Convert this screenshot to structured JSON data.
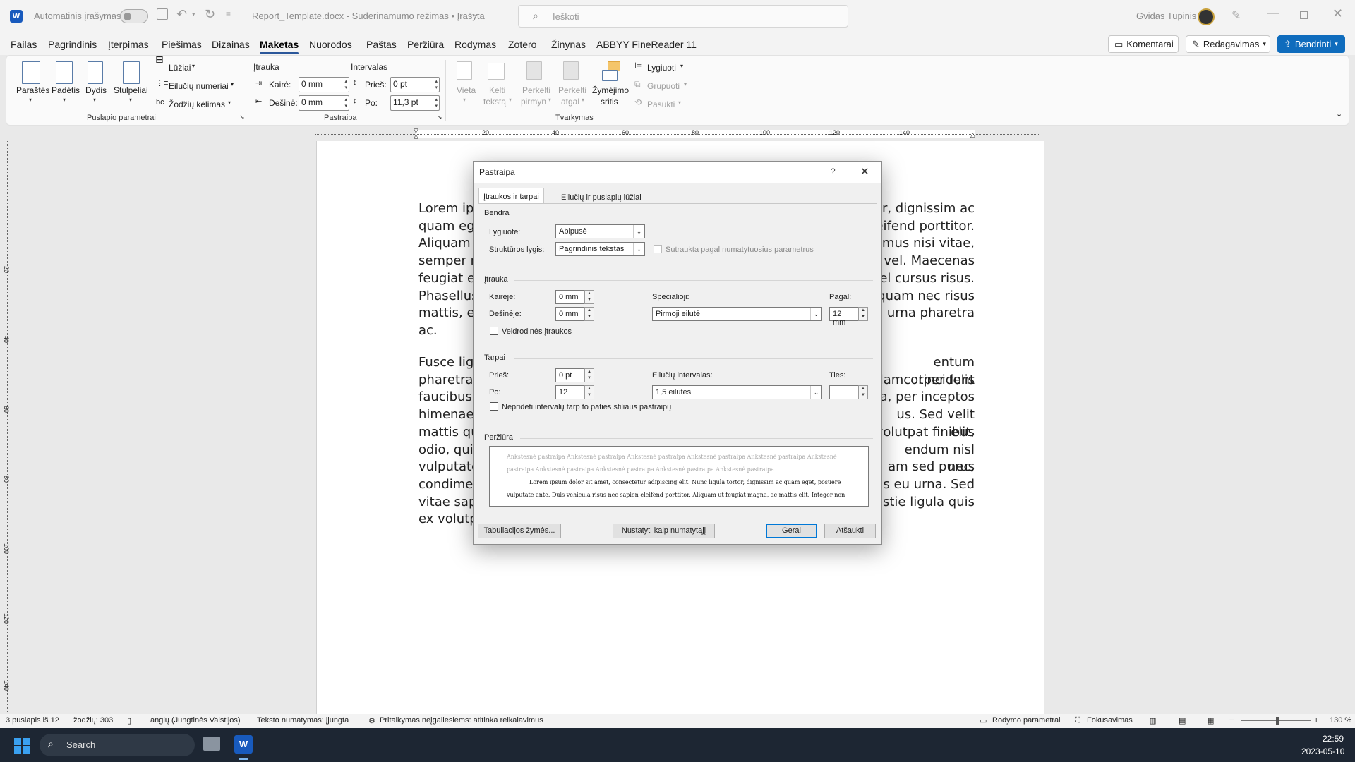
{
  "titlebar": {
    "autosave_label": "Automatinis įrašymas",
    "doc_title": "Report_Template.docx  -  Suderinamumo režimas  •  Įrašyta",
    "search_placeholder": "Ieškoti",
    "user_name": "Gvidas Tupinis"
  },
  "menu": {
    "items": [
      "Failas",
      "Pagrindinis",
      "Įterpimas",
      "Piešimas",
      "Dizainas",
      "Maketas",
      "Nuorodos",
      "Paštas",
      "Peržiūra",
      "Rodymas",
      "Zotero",
      "Žinynas",
      "ABBYY FineReader 11"
    ],
    "active": "Maketas",
    "comments_btn": "Komentarai",
    "editing_btn": "Redagavimas",
    "share_btn": "Bendrinti"
  },
  "ribbon": {
    "page_setup": {
      "margins": "Paraštės",
      "orientation": "Padėtis",
      "size": "Dydis",
      "columns": "Stulpeliai",
      "breaks": "Lūžiai",
      "line_numbers": "Eilučių numeriai",
      "hyphenation": "Žodžių kėlimas",
      "group_label": "Puslapio parametrai"
    },
    "paragraph": {
      "indent_title": "Įtrauka",
      "spacing_title": "Intervalas",
      "left_label": "Kairė:",
      "left_value": "0 mm",
      "right_label": "Dešinė:",
      "right_value": "0 mm",
      "before_label": "Prieš:",
      "before_value": "0 pt",
      "after_label": "Po:",
      "after_value": "11,3 pt",
      "group_label": "Pastraipa"
    },
    "arrange": {
      "position": "Vieta",
      "wrap_text_1": "Kelti",
      "wrap_text_2": "tekstą",
      "bring_forward_1": "Perkelti",
      "bring_forward_2": "pirmyn",
      "send_backward_1": "Perkelti",
      "send_backward_2": "atgal",
      "selection_pane_1": "Žymėjimo",
      "selection_pane_2": "sritis",
      "align": "Lygiuoti",
      "group": "Grupuoti",
      "rotate": "Pasukti",
      "group_label": "Tvarkymas"
    }
  },
  "ruler": {
    "top_ticks": [
      "20",
      "40",
      "60",
      "80",
      "100",
      "120",
      "140"
    ],
    "left_ticks": [
      "20",
      "40",
      "60",
      "80",
      "100",
      "120",
      "140"
    ]
  },
  "document": {
    "para1_lines": [
      "Lorem ip",
      "quam eg",
      "Aliquam",
      "semper n",
      "feugiat e",
      "Phasellus",
      "mattis, e",
      "ac."
    ],
    "para1_right": [
      "or, dignissim ac",
      "eifend porttitor.",
      "imus nisi vitae,",
      "vel. Maecenas",
      "el cursus risus.",
      "quam nec risus",
      "urna pharetra",
      ""
    ],
    "para2_lines": [
      "Fusce lig",
      "pharetra",
      "faucibus",
      "himenaeo",
      "mattis qu",
      "odio, qui",
      "vulputate",
      "condime",
      "vitae sap",
      "ex volutp"
    ],
    "para2_right": [
      "entum tincidunt",
      "llamcorper felis",
      "ra, per inceptos",
      "us. Sed velit elit,",
      "volutpat finibus",
      "endum nisl nec,",
      "am sed purus",
      "s eu urna. Sed",
      "estie ligula quis",
      ""
    ]
  },
  "dialog": {
    "title": "Pastraipa",
    "help": "?",
    "tabs": [
      "Įtraukos ir tarpai",
      "Eilučių ir puslapių lūžiai"
    ],
    "general": {
      "section": "Bendra",
      "alignment_label": "Lygiuotė:",
      "alignment_value": "Abipusė",
      "outline_label": "Struktūros lygis:",
      "outline_value": "Pagrindinis tekstas",
      "collapsed_label": "Sutraukta pagal numatytuosius parametrus"
    },
    "indentation": {
      "section": "Įtrauka",
      "left_label": "Kairėje:",
      "left_value": "0 mm",
      "right_label": "Dešinėje:",
      "right_value": "0 mm",
      "special_label": "Specialioji:",
      "special_value": "Pirmoji eilutė",
      "by_label": "Pagal:",
      "by_value": "12 mm",
      "mirror_label": "Veidrodinės įtraukos"
    },
    "spacing": {
      "section": "Tarpai",
      "before_label": "Prieš:",
      "before_value": "0 pt",
      "after_label": "Po:",
      "after_value": "12",
      "line_spacing_label": "Eilučių intervalas:",
      "line_spacing_value": "1,5 eilutės",
      "at_label": "Ties:",
      "at_value": "",
      "dont_add_label": "Nepridėti intervalų tarp to paties stiliaus pastraipų"
    },
    "preview": {
      "section": "Peržiūra",
      "prev_line1": "Ankstesnė pastraipa Ankstesnė pastraipa Ankstesnė pastraipa Ankstesnė pastraipa Ankstesnė pastraipa Ankstesnė",
      "prev_line2": "pastraipa Ankstesnė pastraipa Ankstesnė pastraipa Ankstesnė pastraipa Ankstesnė pastraipa",
      "cur_line1": "Lorem ipsum dolor sit amet, consectetur adipiscing elit. Nunc ligula tortor, dignissim ac quam eget, posuere",
      "cur_line2": "vulputate ante. Duis vehicula risus nec sapien eleifend porttitor. Aliquam ut feugiat magna, ac mattis elit. Integer non"
    },
    "buttons": {
      "tabs": "Tabuliacijos žymės...",
      "set_default": "Nustatyti kaip numatytąjį",
      "ok": "Gerai",
      "cancel": "Atšaukti"
    }
  },
  "statusbar": {
    "page": "3 puslapis iš 12",
    "words": "žodžių: 303",
    "language": "anglų (Jungtinės Valstijos)",
    "predictions": "Teksto numatymas: įjungta",
    "accessibility": "Pritaikymas neįgaliesiems: atitinka reikalavimus",
    "display_settings": "Rodymo parametrai",
    "focus": "Fokusavimas",
    "zoom": "130 %"
  },
  "taskbar": {
    "search": "Search",
    "time": "22:59",
    "date": "2023-05-10"
  },
  "colors": {
    "accent": "#185abd",
    "word_blue": "#2b579a",
    "share_bg": "#0f6cbd"
  }
}
